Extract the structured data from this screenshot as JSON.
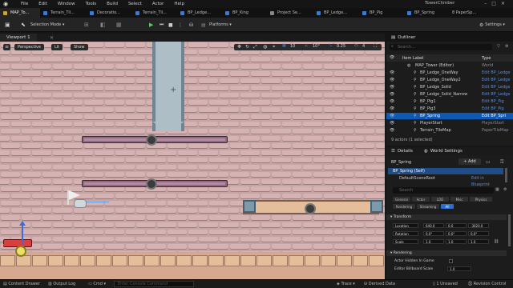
{
  "app": {
    "title": "TowerClimber"
  },
  "menu": [
    "File",
    "Edit",
    "Window",
    "Tools",
    "Build",
    "Select",
    "Actor",
    "Help"
  ],
  "tabs": [
    {
      "label": "MAP_To...",
      "active": true
    },
    {
      "label": "Terrain_Til...",
      "active": false
    },
    {
      "label": "Decoratio...",
      "active": false
    },
    {
      "label": "Terrain_Til...",
      "active": false
    },
    {
      "label": "BP_Ledge...",
      "active": false
    },
    {
      "label": "BP_King",
      "active": false
    },
    {
      "label": "Project Se...",
      "active": false
    },
    {
      "label": "BP_Ledge...",
      "active": false
    },
    {
      "label": "BP_Pig",
      "active": false
    },
    {
      "label": "BP_Spring",
      "active": false
    },
    {
      "label": "8 PaperSp...",
      "active": false
    }
  ],
  "toolbar": {
    "selection_mode": "Selection Mode",
    "platforms": "Platforms",
    "settings": "Settings"
  },
  "viewport": {
    "tab_label": "Viewport 1",
    "perspective": "Perspective",
    "lit": "Lit",
    "show": "Show",
    "grid_value": "10",
    "rot_value": "10°",
    "scale_value": "0.25",
    "cam_value": "4"
  },
  "outliner": {
    "title": "Outliner",
    "search_placeholder": "Search...",
    "col_label": "Item Label",
    "col_type": "Type",
    "actor_count": "9 actors (1 selected)",
    "rows": [
      {
        "label": "MAP_Tower (Editor)",
        "type": "World",
        "selected": false
      },
      {
        "label": "BP_Ledge_OneWay",
        "type": "Edit BP_Ledge",
        "selected": false
      },
      {
        "label": "BP_Ledge_OneWay2",
        "type": "Edit BP_Ledge",
        "selected": false
      },
      {
        "label": "BP_Ledge_Solid",
        "type": "Edit BP_Ledge",
        "selected": false
      },
      {
        "label": "BP_Ledge_Solid_Narrow",
        "type": "Edit BP_Ledge",
        "selected": false
      },
      {
        "label": "BP_Pig1",
        "type": "Edit BP_Pig",
        "selected": false
      },
      {
        "label": "BP_Pig3",
        "type": "Edit BP_Pig",
        "selected": false
      },
      {
        "label": "BP_Spring",
        "type": "Edit BP_Spri",
        "selected": true
      },
      {
        "label": "PlayerStart",
        "type": "PlayerStart",
        "selected": false
      },
      {
        "label": "Terrain_TileMap",
        "type": "PaperTileMap",
        "selected": false
      }
    ]
  },
  "details": {
    "tab_details": "Details",
    "tab_world": "World Settings",
    "object_name": "BP_Spring",
    "add_label": "+ Add",
    "self_label": "BP_Spring (Self)",
    "root_label": "DefaultSceneRoot",
    "edit_blueprint": "Edit in Blueprint",
    "search_placeholder": "Search",
    "filters": [
      "General",
      "Actor",
      "LOD",
      "Misc",
      "Physics",
      "Rendering",
      "Streaming",
      "All"
    ],
    "transform": {
      "section": "Transform",
      "location_label": "Location",
      "location": [
        "640.0",
        "0.0",
        "-3020.0"
      ],
      "rotation_label": "Rotation",
      "rotation": [
        "0.0°",
        "0.0°",
        "0.0°"
      ],
      "scale_label": "Scale",
      "scale": [
        "1.0",
        "1.0",
        "1.0"
      ]
    },
    "rendering": {
      "section": "Rendering",
      "hidden_label": "Actor Hidden In Game",
      "billboard_label": "Editor Billboard Scale",
      "billboard_value": "1.0"
    }
  },
  "status": {
    "content_drawer": "Content Drawer",
    "output_log": "Output Log",
    "cmd": "Cmd",
    "console_placeholder": "Enter Console Command",
    "trace": "Trace",
    "derived_data": "Derived Data",
    "unsaved": "1 Unsaved",
    "revision_control": "Revision Control"
  },
  "colors": {
    "selected": "#0e5ab3",
    "accent_blue": "#3a7bd5",
    "play_green": "#5cc85c"
  }
}
